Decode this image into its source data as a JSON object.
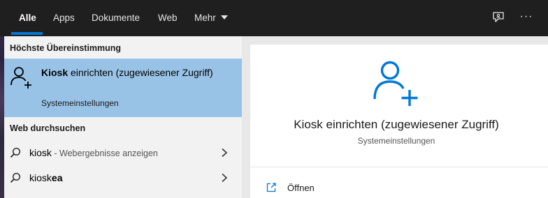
{
  "topbar": {
    "tabs": [
      {
        "label": "Alle",
        "active": true
      },
      {
        "label": "Apps"
      },
      {
        "label": "Dokumente"
      },
      {
        "label": "Web"
      },
      {
        "label": "Mehr"
      }
    ],
    "feedback_icon": "feedback-icon",
    "more_options_icon": "ellipsis-icon",
    "more_options_label": "···"
  },
  "best_match": {
    "heading": "Höchste Übereinstimmung",
    "title_bold": "Kiosk",
    "title_rest": " einrichten (zugewiesener Zugriff)",
    "subtitle": "Systemeinstellungen",
    "icon": "add-user-icon"
  },
  "web_search": {
    "heading": "Web durchsuchen",
    "items": [
      {
        "query": "kiosk",
        "hint": " - Webergebnisse anzeigen"
      },
      {
        "query_prefix": "kiosk",
        "query_suffix": "ea"
      }
    ]
  },
  "detail": {
    "title": "Kiosk einrichten (zugewiesener Zugriff)",
    "subtitle": "Systemeinstellungen",
    "actions": [
      {
        "label": "Öffnen",
        "icon": "open-icon"
      }
    ],
    "icon": "add-user-icon"
  },
  "colors": {
    "accent": "#0078d7",
    "topbar_bg": "#1f1f1f",
    "selected_bg": "#99c3e6"
  }
}
